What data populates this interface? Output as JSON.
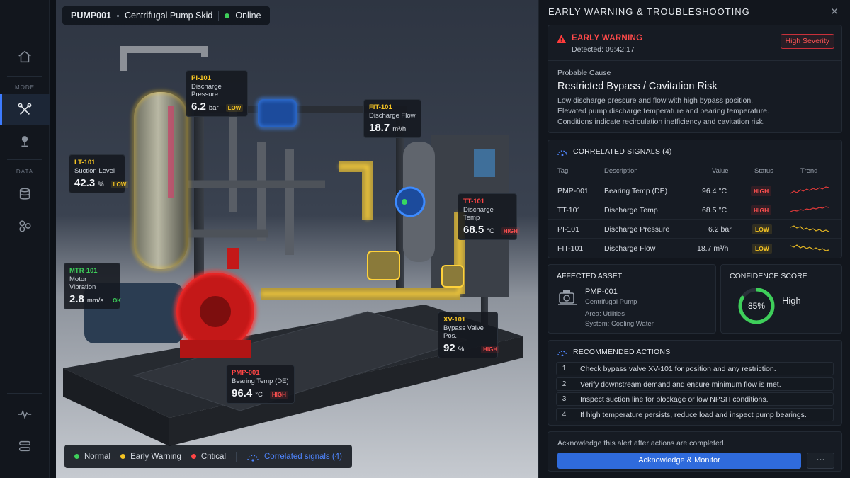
{
  "asset": {
    "id": "PUMP001",
    "name": "Centrifugal Pump Skid",
    "status": "Online",
    "status_color": "#3ecf5a"
  },
  "rail": {
    "mode_label": "MODE",
    "data_label": "DATA"
  },
  "tags": [
    {
      "id": "PI-101",
      "desc": "Discharge Pressure",
      "value": "6.2",
      "unit": "bar",
      "status": "LOW"
    },
    {
      "id": "FIT-101",
      "desc": "Discharge Flow",
      "value": "18.7",
      "unit": "m³/h"
    },
    {
      "id": "LT-101",
      "desc": "Suction Level",
      "value": "42.3",
      "unit": "%",
      "status": "LOW"
    },
    {
      "id": "TT-101",
      "desc": "Discharge Temp",
      "value": "68.5",
      "unit": "°C",
      "status": "HIGH"
    },
    {
      "id": "MTR-101",
      "desc": "Motor Vibration",
      "value": "2.8",
      "unit": "mm/s",
      "status": "OK"
    },
    {
      "id": "XV-101",
      "desc": "Bypass Valve Pos.",
      "value": "92",
      "unit": "%",
      "status": "HIGH"
    },
    {
      "id": "PMP-001",
      "desc": "Bearing Temp (DE)",
      "value": "96.4",
      "unit": "°C",
      "status": "HIGH"
    }
  ],
  "legend": {
    "normal": "Normal",
    "early_warning": "Early Warning",
    "critical": "Critical",
    "correlated": "Correlated signals (4)"
  },
  "panel": {
    "title": "EARLY WARNING & TROUBLESHOOTING",
    "close": "✕",
    "alert": {
      "title": "EARLY WARNING",
      "detected": "Detected: 09:42:17",
      "severity": "High Severity",
      "cause_label": "Probable Cause",
      "cause_title": "Restricted Bypass / Cavitation Risk",
      "cause_lines": [
        "Low discharge pressure and flow with high bypass position.",
        "Elevated pump discharge temperature and bearing temperature.",
        "Conditions indicate recirculation inefficiency and cavitation risk."
      ]
    },
    "signals": {
      "title": "CORRELATED SIGNALS (4)",
      "headers": {
        "tag": "Tag",
        "desc": "Description",
        "value": "Value",
        "status": "Status",
        "trend": "Trend"
      },
      "rows": [
        {
          "tag": "PMP-001",
          "desc": "Bearing Temp (DE)",
          "value": "96.4 °C",
          "status": "HIGH"
        },
        {
          "tag": "TT-101",
          "desc": "Discharge Temp",
          "value": "68.5 °C",
          "status": "HIGH"
        },
        {
          "tag": "PI-101",
          "desc": "Discharge Pressure",
          "value": "6.2 bar",
          "status": "LOW"
        },
        {
          "tag": "FIT-101",
          "desc": "Discharge Flow",
          "value": "18.7 m³/h",
          "status": "LOW"
        }
      ]
    },
    "affected": {
      "label": "AFFECTED ASSET",
      "id": "PMP-001",
      "type": "Centrifugal Pump",
      "area": "Area: Utilities",
      "system": "System: Cooling Water"
    },
    "confidence": {
      "label": "CONFIDENCE SCORE",
      "percent": 85,
      "percent_text": "85%",
      "level": "High"
    },
    "actions": {
      "title": "RECOMMENDED ACTIONS",
      "items": [
        {
          "num": "1",
          "text": "Check bypass valve XV-101 for position and any restriction."
        },
        {
          "num": "2",
          "text": "Verify downstream demand and ensure minimum flow is met."
        },
        {
          "num": "3",
          "text": "Inspect suction line for blockage or low NPSH conditions."
        },
        {
          "num": "4",
          "text": "If high temperature persists, reduce load and inspect pump bearings."
        }
      ]
    },
    "acknowledge": {
      "text": "Acknowledge this alert after actions are completed.",
      "button": "Acknowledge & Monitor",
      "more": "⋯"
    }
  },
  "colors": {
    "normal": "#3ecf5a",
    "warning": "#f5c423",
    "critical": "#ff4545",
    "accent": "#3d7bff"
  }
}
